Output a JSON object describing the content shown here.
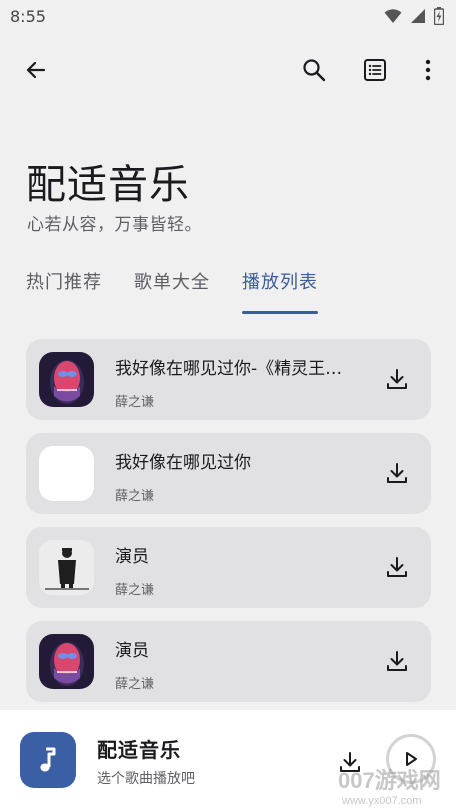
{
  "status_bar": {
    "time": "8:55",
    "icons": [
      "wifi-icon",
      "signal-icon",
      "battery-icon"
    ]
  },
  "app_bar": {
    "icons": [
      "back-arrow-icon",
      "search-icon",
      "playlist-icon",
      "more-vert-icon"
    ]
  },
  "header": {
    "title": "配适音乐",
    "subtitle": "心若从容，万事皆轻。"
  },
  "tabs": [
    {
      "label": "热门推荐",
      "active": false
    },
    {
      "label": "歌单大全",
      "active": false
    },
    {
      "label": "播放列表",
      "active": true
    }
  ],
  "songs": [
    {
      "title": "我好像在哪见过你-《精灵王…",
      "artist": "薛之谦",
      "cover": "face-art"
    },
    {
      "title": "我好像在哪见过你",
      "artist": "薛之谦",
      "cover": "blank"
    },
    {
      "title": "演员",
      "artist": "薛之谦",
      "cover": "figure-photo"
    },
    {
      "title": "演员",
      "artist": "薛之谦",
      "cover": "face-art"
    }
  ],
  "player": {
    "title": "配适音乐",
    "subtitle": "选个歌曲播放吧",
    "icons": [
      "music-note-icon",
      "download-icon",
      "play-icon"
    ]
  },
  "watermark": {
    "text": "007游戏网",
    "url": "www.yx007.com"
  },
  "colors": {
    "background": "#f0f0f1",
    "card": "#e1e1e4",
    "accent": "#3d5c9a",
    "player_art": "#3a5fa4"
  }
}
